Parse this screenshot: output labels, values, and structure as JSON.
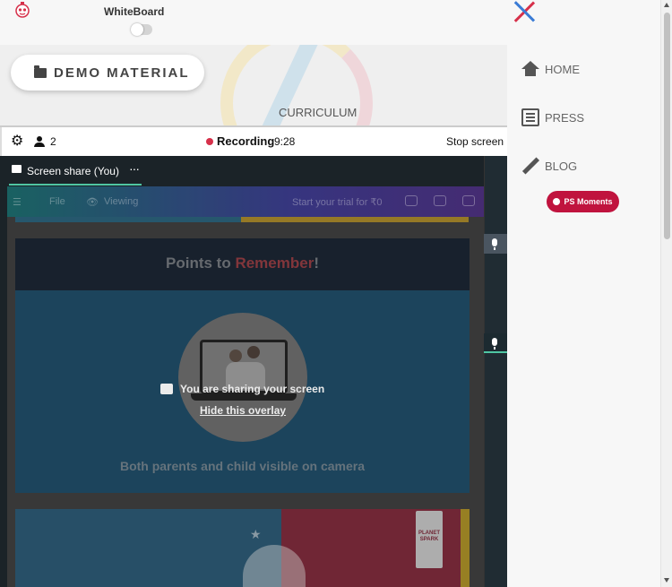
{
  "topbar": {
    "logo_icon": "planet-spark-logo-icon",
    "whiteboard_label": "WhiteBoard",
    "whiteboard_toggle_on": false
  },
  "main": {
    "demo_material_label": "DEMO MATERIAL",
    "curriculum_label": "CURRICULUM"
  },
  "call": {
    "participant_count": "2",
    "recording_label": "Recording",
    "recording_time": "9:28",
    "stop_screen_label": "Stop screen",
    "tab_label": "Screen share (You)",
    "tab_more": "···",
    "sharing_text": "You are sharing your screen",
    "hide_overlay_label": "Hide this overlay",
    "recording_color": "#d6304a",
    "accent_color": "#4fc6a3"
  },
  "shared_screen": {
    "menu_file": "File",
    "menu_viewing": "Viewing",
    "trial_text": "Start your trial for ₹0",
    "slide_title_part1": "Points to ",
    "slide_title_highlight": "Remember",
    "slide_title_part2": "!",
    "slide_footer": "Both parents and child visible on camera",
    "brand_tag": "PLANET SPARK"
  },
  "sidebar": {
    "items": [
      {
        "label": "HOME",
        "icon": "home-icon"
      },
      {
        "label": "PRESS",
        "icon": "newspaper-icon"
      },
      {
        "label": "BLOG",
        "icon": "pencil-icon"
      }
    ],
    "ps_moments_label": "PS Moments",
    "ps_moments_color": "#c0133e"
  }
}
